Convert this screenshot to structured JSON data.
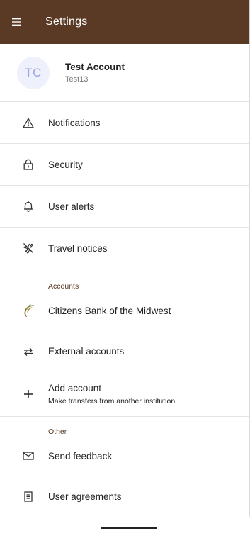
{
  "app_bar": {
    "title": "Settings",
    "background": "#5a3a24",
    "menu_icon": "hamburger-menu-icon"
  },
  "profile": {
    "initials": "TC",
    "name": "Test Account",
    "username": "Test13"
  },
  "settings_items": [
    {
      "icon": "warning-triangle-icon",
      "label": "Notifications"
    },
    {
      "icon": "lock-icon",
      "label": "Security"
    },
    {
      "icon": "bell-icon",
      "label": "User alerts"
    },
    {
      "icon": "airplane-off-icon",
      "label": "Travel notices"
    }
  ],
  "accounts_section": {
    "header": "Accounts",
    "items": [
      {
        "icon": "bank-logo-icon",
        "label": "Citizens Bank of the Midwest"
      },
      {
        "icon": "transfer-arrows-icon",
        "label": "External accounts"
      },
      {
        "icon": "plus-icon",
        "label": "Add account",
        "sublabel": "Make transfers from another institution."
      }
    ]
  },
  "other_section": {
    "header": "Other",
    "items": [
      {
        "icon": "envelope-icon",
        "label": "Send feedback"
      },
      {
        "icon": "document-icon",
        "label": "User agreements"
      }
    ]
  }
}
